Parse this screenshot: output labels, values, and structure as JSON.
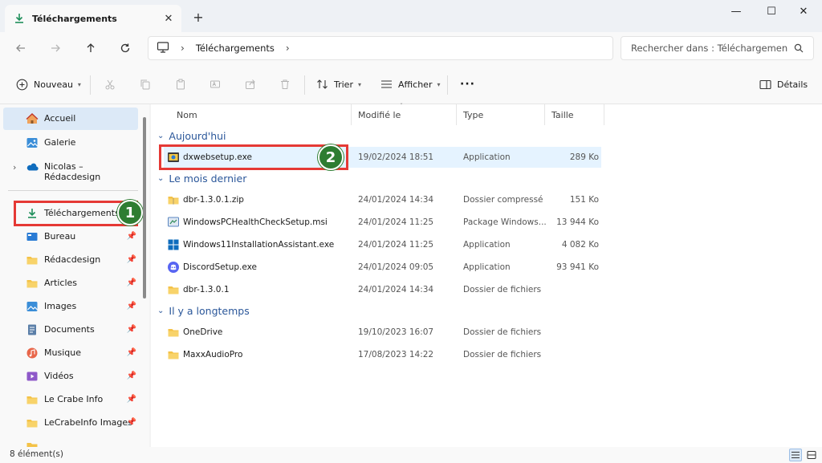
{
  "window": {
    "tab_title": "Téléchargements",
    "tab_close": "✕",
    "new_tab": "+",
    "minimize": "—",
    "maximize": "☐",
    "close": "✕"
  },
  "address": {
    "crumb": "Téléchargements",
    "search_placeholder": "Rechercher dans : Téléchargemen"
  },
  "commandbar": {
    "new_label": "Nouveau",
    "sort_label": "Trier",
    "view_label": "Afficher",
    "more_label": "···",
    "details_label": "Détails"
  },
  "sidebar": {
    "items": [
      {
        "label": "Accueil",
        "icon": "home-icon"
      },
      {
        "label": "Galerie",
        "icon": "gallery-icon"
      },
      {
        "label": "Nicolas – Rédacdesign",
        "icon": "onedrive-icon"
      },
      {
        "label": "Téléchargements",
        "icon": "download-icon"
      },
      {
        "label": "Bureau",
        "icon": "desktop-icon"
      },
      {
        "label": "Rédacdesign",
        "icon": "folder-icon"
      },
      {
        "label": "Articles",
        "icon": "folder-icon"
      },
      {
        "label": "Images",
        "icon": "images-icon"
      },
      {
        "label": "Documents",
        "icon": "documents-icon"
      },
      {
        "label": "Musique",
        "icon": "music-icon"
      },
      {
        "label": "Vidéos",
        "icon": "videos-icon"
      },
      {
        "label": "Le Crabe Info",
        "icon": "folder-icon"
      },
      {
        "label": "LeCrabeInfo Images",
        "icon": "folder-icon"
      }
    ]
  },
  "columns": {
    "name": "Nom",
    "modified": "Modifié le",
    "type": "Type",
    "size": "Taille"
  },
  "groups": {
    "today": "Aujourd'hui",
    "last_month": "Le mois dernier",
    "long_ago": "Il y a longtemps"
  },
  "files": {
    "today": [
      {
        "name": "dxwebsetup.exe",
        "date": "19/02/2024 18:51",
        "type": "Application",
        "size": "289 Ko",
        "icon": "installer-icon"
      }
    ],
    "last_month": [
      {
        "name": "dbr-1.3.0.1.zip",
        "date": "24/01/2024 14:34",
        "type": "Dossier compressé",
        "size": "151 Ko",
        "icon": "zip-folder-icon"
      },
      {
        "name": "WindowsPCHealthCheckSetup.msi",
        "date": "24/01/2024 11:25",
        "type": "Package Windows...",
        "size": "13 944 Ko",
        "icon": "msi-icon"
      },
      {
        "name": "Windows11InstallationAssistant.exe",
        "date": "24/01/2024 11:25",
        "type": "Application",
        "size": "4 082 Ko",
        "icon": "windows-icon"
      },
      {
        "name": "DiscordSetup.exe",
        "date": "24/01/2024 09:05",
        "type": "Application",
        "size": "93 941 Ko",
        "icon": "discord-icon"
      },
      {
        "name": "dbr-1.3.0.1",
        "date": "24/01/2024 14:34",
        "type": "Dossier de fichiers",
        "size": "",
        "icon": "folder-icon"
      }
    ],
    "long_ago": [
      {
        "name": "OneDrive",
        "date": "19/10/2023 16:07",
        "type": "Dossier de fichiers",
        "size": "",
        "icon": "folder-icon"
      },
      {
        "name": "MaxxAudioPro",
        "date": "17/08/2023 14:22",
        "type": "Dossier de fichiers",
        "size": "",
        "icon": "folder-icon"
      }
    ]
  },
  "annotations": {
    "badge1": "1",
    "badge2": "2"
  },
  "status": {
    "count": "8 élément(s)"
  },
  "colors": {
    "accent": "#2b579a",
    "highlight": "#e53935",
    "badge": "#2e7d32",
    "selection": "#e5f3ff"
  }
}
